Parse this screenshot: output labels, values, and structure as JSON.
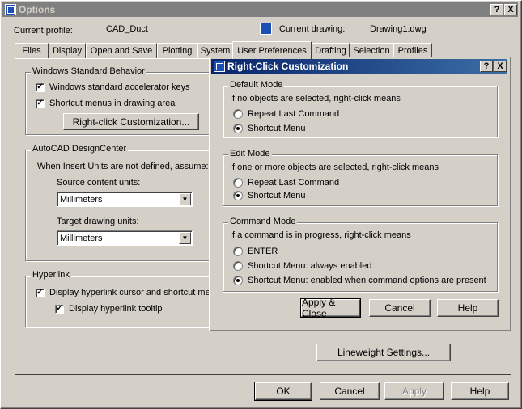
{
  "options": {
    "title": "Options",
    "help_btn": "?",
    "close_btn": "X",
    "current_profile_label": "Current profile:",
    "current_profile_value": "CAD_Duct",
    "current_drawing_label": "Current drawing:",
    "current_drawing_value": "Drawing1.dwg",
    "tabs": [
      "Files",
      "Display",
      "Open and Save",
      "Plotting",
      "System",
      "User Preferences",
      "Drafting",
      "Selection",
      "Profiles"
    ],
    "selected_tab": "User Preferences",
    "windows_group": {
      "label": "Windows Standard Behavior",
      "accel_keys": "Windows standard accelerator keys",
      "shortcut_menus": "Shortcut menus in drawing area",
      "rc_button": "Right-click Customization..."
    },
    "design_center": {
      "label": "AutoCAD DesignCenter",
      "note": "When Insert Units are not defined, assume:",
      "source_label": "Source content units:",
      "source_value": "Millimeters",
      "target_label": "Target drawing units:",
      "target_value": "Millimeters"
    },
    "hyperlink": {
      "label": "Hyperlink",
      "display_cursor": "Display hyperlink cursor and shortcut menu",
      "display_tooltip": "Display hyperlink tooltip"
    },
    "lineweight_btn": "Lineweight Settings...",
    "ok_btn": "OK",
    "cancel_btn": "Cancel",
    "apply_btn": "Apply",
    "help_btn_label": "Help"
  },
  "rc_dialog": {
    "title": "Right-Click Customization",
    "help_btn": "?",
    "close_btn": "X",
    "default_mode": {
      "label": "Default Mode",
      "desc": "If no objects are selected, right-click means",
      "opt1": "Repeat Last Command",
      "opt2": "Shortcut Menu"
    },
    "edit_mode": {
      "label": "Edit Mode",
      "desc": "If one or more objects are selected, right-click means",
      "opt1": "Repeat Last Command",
      "opt2": "Shortcut Menu"
    },
    "command_mode": {
      "label": "Command Mode",
      "desc": "If a command is in progress, right-click means",
      "opt1": "ENTER",
      "opt2": "Shortcut Menu: always enabled",
      "opt3": "Shortcut Menu: enabled when command options are present"
    },
    "apply_close_btn": "Apply & Close",
    "cancel_btn": "Cancel",
    "help_btn_label": "Help"
  }
}
